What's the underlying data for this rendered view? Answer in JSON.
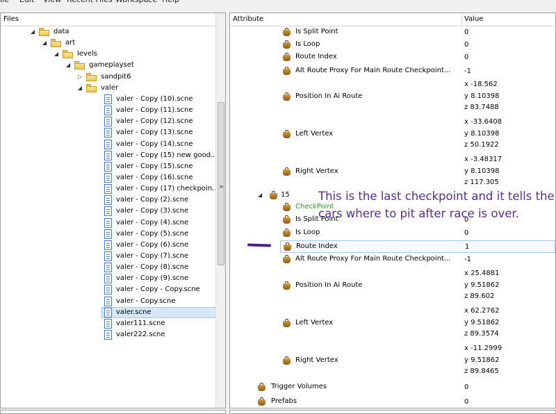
{
  "menubar": {
    "items": [
      "ile",
      "Edit",
      "View",
      "Recent Files",
      "Workspace",
      "Help"
    ]
  },
  "files": {
    "header": "Files",
    "tree": [
      {
        "label": "data",
        "type": "folder",
        "level": 0,
        "expanded": true
      },
      {
        "label": "art",
        "type": "folder",
        "level": 1,
        "expanded": true
      },
      {
        "label": "levels",
        "type": "folder",
        "level": 2,
        "expanded": true
      },
      {
        "label": "gameplayset",
        "type": "folder",
        "level": 3,
        "expanded": true
      },
      {
        "label": "sandpit6",
        "type": "folder",
        "level": 4,
        "expanded": false
      },
      {
        "label": "valer",
        "type": "folder",
        "level": 4,
        "expanded": true
      },
      {
        "label": "valer - Copy (10).scne",
        "type": "file",
        "level": 5
      },
      {
        "label": "valer - Copy (11).scne",
        "type": "file",
        "level": 5
      },
      {
        "label": "valer - Copy (12).scne",
        "type": "file",
        "level": 5
      },
      {
        "label": "valer - Copy (13).scne",
        "type": "file",
        "level": 5
      },
      {
        "label": "valer - Copy (14).scne",
        "type": "file",
        "level": 5
      },
      {
        "label": "valer - Copy (15) new good...",
        "type": "file",
        "level": 5
      },
      {
        "label": "valer - Copy (15).scne",
        "type": "file",
        "level": 5
      },
      {
        "label": "valer - Copy (16).scne",
        "type": "file",
        "level": 5
      },
      {
        "label": "valer - Copy (17) checkpoin...",
        "type": "file",
        "level": 5
      },
      {
        "label": "valer - Copy (2).scne",
        "type": "file",
        "level": 5
      },
      {
        "label": "valer - Copy (3).scne",
        "type": "file",
        "level": 5
      },
      {
        "label": "valer - Copy (4).scne",
        "type": "file",
        "level": 5
      },
      {
        "label": "valer - Copy (5).scne",
        "type": "file",
        "level": 5
      },
      {
        "label": "valer - Copy (6).scne",
        "type": "file",
        "level": 5
      },
      {
        "label": "valer - Copy (7).scne",
        "type": "file",
        "level": 5
      },
      {
        "label": "valer - Copy (8).scne",
        "type": "file",
        "level": 5
      },
      {
        "label": "valer - Copy (9).scne",
        "type": "file",
        "level": 5
      },
      {
        "label": "valer - Copy - Copy.scne",
        "type": "file",
        "level": 5
      },
      {
        "label": "valer - Copy.scne",
        "type": "file",
        "level": 5
      },
      {
        "label": "valer.scne",
        "type": "file",
        "level": 5,
        "selected": true
      },
      {
        "label": "valer111.scne",
        "type": "file",
        "level": 5
      },
      {
        "label": "valer222.scne",
        "type": "file",
        "level": 5
      }
    ]
  },
  "attributes": {
    "header_attribute": "Attribute",
    "header_value": "Value",
    "rows": [
      {
        "name": "Is Split Point",
        "values": [
          "0"
        ],
        "indent": 1
      },
      {
        "name": "Is Loop",
        "values": [
          "0"
        ],
        "indent": 1
      },
      {
        "name": "Route Index",
        "values": [
          "0"
        ],
        "indent": 1
      },
      {
        "name": "Alt Route Proxy For Main Route Checkpoint...",
        "values": [
          "-1"
        ],
        "indent": 1
      },
      {
        "name": "Position In Ai Route",
        "values": [
          "x -18.562",
          "y 8.10398",
          "z 83.7488"
        ],
        "indent": 1
      },
      {
        "name": "Left Vertex",
        "values": [
          "x -33.6408",
          "y 8.10398",
          "z 50.1922"
        ],
        "indent": 1
      },
      {
        "name": "Right Vertex",
        "values": [
          "x -3.48317",
          "y 8.10398",
          "z 117.305"
        ],
        "indent": 1
      },
      {
        "name": "15",
        "values": [],
        "indent": 0,
        "expanded": true
      },
      {
        "name": "CheckPoint",
        "values": [],
        "indent": 1,
        "green": true
      },
      {
        "name": "Is Split Point",
        "values": [
          "0"
        ],
        "indent": 1
      },
      {
        "name": "Is Loop",
        "values": [
          "0"
        ],
        "indent": 1
      },
      {
        "name": "Route Index",
        "values": [
          "1"
        ],
        "indent": 1,
        "highlight": true
      },
      {
        "name": "Alt Route Proxy For Main Route Checkpoint...",
        "values": [
          "-1"
        ],
        "indent": 1
      },
      {
        "name": "Position In Ai Route",
        "values": [
          "x 25.4881",
          "y 9.51862",
          "z 89.602"
        ],
        "indent": 1
      },
      {
        "name": "Left Vertex",
        "values": [
          "x 62.2762",
          "y 9.51862",
          "z 89.3574"
        ],
        "indent": 1
      },
      {
        "name": "Right Vertex",
        "values": [
          "x -11.2999",
          "y 9.51862",
          "z 89.8465"
        ],
        "indent": 1
      },
      {
        "name": "Trigger Volumes",
        "values": [
          "0"
        ],
        "indent": -1
      },
      {
        "name": "Prefabs",
        "values": [
          "0"
        ],
        "indent": -1
      }
    ]
  },
  "annotation": {
    "text": "This is the last checkpoint and it tells the cars where to pit after race is over.",
    "color": "#5b2d91"
  },
  "colors": {
    "selection_bg": "#d6e6f7",
    "selection_border": "#a8c8ec",
    "checkpoint_green": "#1e9e1e"
  }
}
